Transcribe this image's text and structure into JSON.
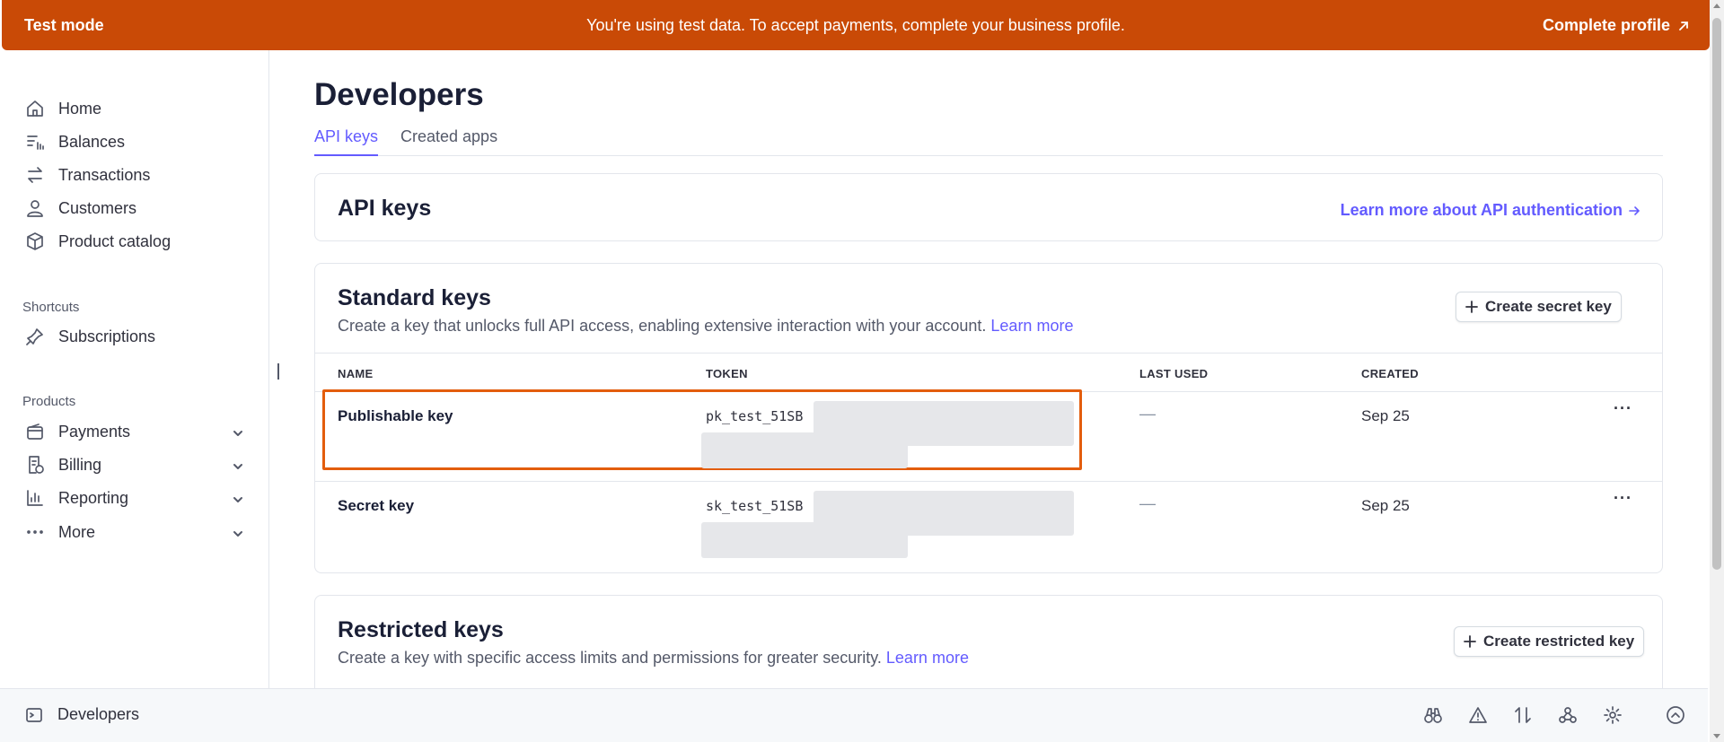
{
  "banner": {
    "label": "Test mode",
    "message": "You're using test data. To accept payments, complete your business profile.",
    "cta": "Complete profile"
  },
  "sidebar": {
    "items": [
      {
        "label": "Home",
        "icon": "home-icon"
      },
      {
        "label": "Balances",
        "icon": "balances-icon"
      },
      {
        "label": "Transactions",
        "icon": "transactions-icon"
      },
      {
        "label": "Customers",
        "icon": "customers-icon"
      },
      {
        "label": "Product catalog",
        "icon": "product-catalog-icon"
      }
    ],
    "shortcuts_label": "Shortcuts",
    "shortcuts": [
      {
        "label": "Subscriptions",
        "icon": "pin-icon"
      }
    ],
    "products_label": "Products",
    "products": [
      {
        "label": "Payments",
        "icon": "payments-icon"
      },
      {
        "label": "Billing",
        "icon": "billing-icon"
      },
      {
        "label": "Reporting",
        "icon": "reporting-icon"
      },
      {
        "label": "More",
        "icon": "more-dots-icon"
      }
    ]
  },
  "main": {
    "title": "Developers",
    "tabs": [
      {
        "label": "API keys",
        "active": true
      },
      {
        "label": "Created apps",
        "active": false
      }
    ],
    "api_card": {
      "title": "API keys",
      "learn_link": "Learn more about API authentication"
    },
    "standard": {
      "title": "Standard keys",
      "desc": "Create a key that unlocks full API access, enabling extensive interaction with your account.",
      "learn_more": "Learn more",
      "button": "Create secret key",
      "columns": [
        "NAME",
        "TOKEN",
        "LAST USED",
        "CREATED"
      ],
      "rows": [
        {
          "name": "Publishable key",
          "token": "pk_test_51SB",
          "last_used": "—",
          "created": "Sep 25"
        },
        {
          "name": "Secret key",
          "token": "sk_test_51SB",
          "last_used": "—",
          "created": "Sep 25"
        }
      ]
    },
    "restricted": {
      "title": "Restricted keys",
      "desc": "Create a key with specific access limits and permissions for greater security.",
      "learn_more": "Learn more",
      "button": "Create restricted key"
    }
  },
  "bottom_bar": {
    "label": "Developers",
    "tools": [
      "binoculars-icon",
      "warning-icon",
      "transfer-icon",
      "webhooks-icon",
      "settings-icon",
      "collapse-icon"
    ]
  },
  "colors": {
    "banner": "#c94a06",
    "accent": "#635bff",
    "highlight": "#e35d0d"
  }
}
